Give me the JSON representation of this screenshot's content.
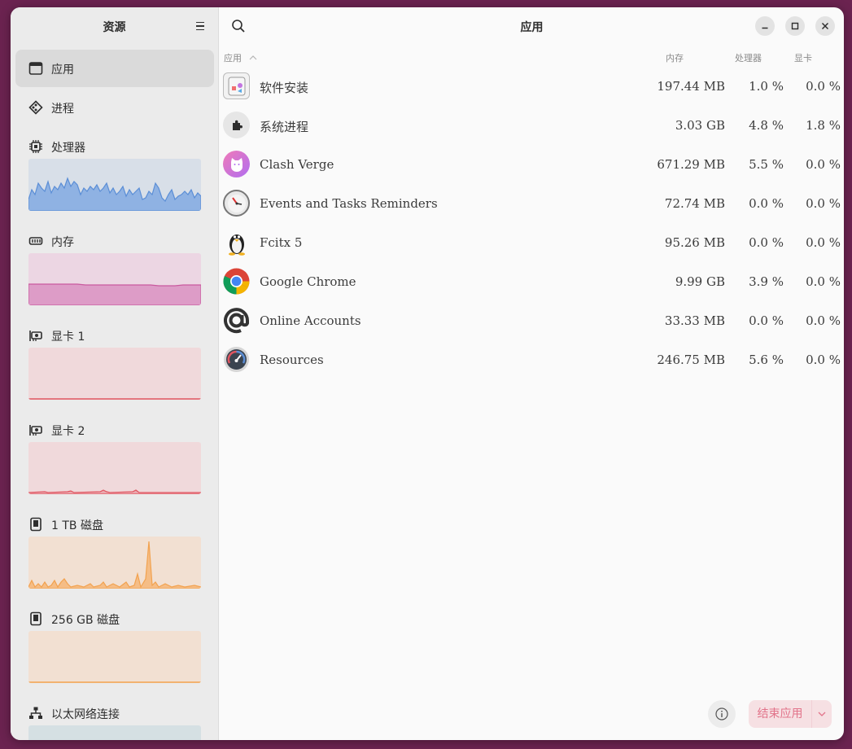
{
  "sidebar": {
    "title": "资源",
    "items": [
      {
        "label": "应用",
        "icon": "window-icon"
      },
      {
        "label": "进程",
        "icon": "processes-icon"
      },
      {
        "label": "处理器",
        "icon": "cpu-icon"
      },
      {
        "label": "内存",
        "icon": "memory-icon"
      },
      {
        "label": "显卡 1",
        "icon": "gpu-icon"
      },
      {
        "label": "显卡 2",
        "icon": "gpu-icon"
      },
      {
        "label": "1 TB 磁盘",
        "icon": "disk-icon"
      },
      {
        "label": "256 GB 磁盘",
        "icon": "disk-icon"
      },
      {
        "label": "以太网络连接",
        "icon": "network-icon"
      }
    ]
  },
  "main": {
    "title": "应用",
    "columns": {
      "app": "应用",
      "memory": "内存",
      "cpu": "处理器",
      "gpu": "显卡"
    },
    "rows": [
      {
        "name": "软件安装",
        "memory": "197.44 MB",
        "cpu": "1.0 %",
        "gpu": "0.0 %",
        "icon": "software-install-icon"
      },
      {
        "name": "系统进程",
        "memory": "3.03 GB",
        "cpu": "4.8 %",
        "gpu": "1.8 %",
        "icon": "puzzle-icon"
      },
      {
        "name": "Clash Verge",
        "memory": "671.29 MB",
        "cpu": "5.5 %",
        "gpu": "0.0 %",
        "icon": "cat-icon"
      },
      {
        "name": "Events and Tasks Reminders",
        "memory": "72.74 MB",
        "cpu": "0.0 %",
        "gpu": "0.0 %",
        "icon": "clock-icon"
      },
      {
        "name": "Fcitx 5",
        "memory": "95.26 MB",
        "cpu": "0.0 %",
        "gpu": "0.0 %",
        "icon": "penguin-icon"
      },
      {
        "name": "Google Chrome",
        "memory": "9.99 GB",
        "cpu": "3.9 %",
        "gpu": "0.0 %",
        "icon": "chrome-icon"
      },
      {
        "name": "Online Accounts",
        "memory": "33.33 MB",
        "cpu": "0.0 %",
        "gpu": "0.0 %",
        "icon": "at-sign-icon"
      },
      {
        "name": "Resources",
        "memory": "246.75 MB",
        "cpu": "5.6 %",
        "gpu": "0.0 %",
        "icon": "gauge-icon"
      }
    ],
    "end_button": "结束应用"
  },
  "colors": {
    "cpu": "#5b8ed6",
    "memory": "#c95a9e",
    "gpu": "#e05560",
    "disk": "#f2a24f",
    "accent_end": "#e2738a"
  }
}
